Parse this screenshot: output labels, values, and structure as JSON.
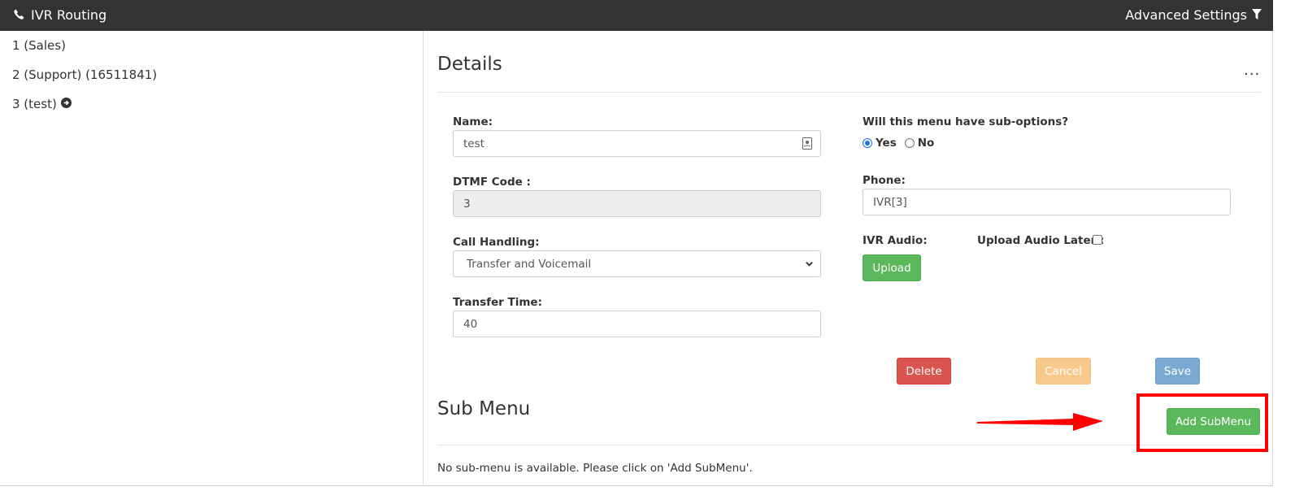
{
  "header": {
    "title": "IVR Routing",
    "advanced": "Advanced Settings"
  },
  "sidebar": {
    "items": [
      {
        "label": "1 (Sales)"
      },
      {
        "label": "2 (Support) (16511841)"
      },
      {
        "label": "3 (test)"
      }
    ]
  },
  "details": {
    "title": "Details",
    "more": "...",
    "name_label": "Name:",
    "name_value": "test",
    "dtmf_label": "DTMF Code :",
    "dtmf_value": "3",
    "call_label": "Call Handling:",
    "call_value": "Transfer and Voicemail",
    "transfer_label": "Transfer Time:",
    "transfer_value": "40",
    "suboptions_label": "Will this menu have sub-options?",
    "yes_label": "Yes",
    "no_label": "No",
    "suboptions_selected": "Yes",
    "phone_label": "Phone:",
    "phone_value": "IVR[3]",
    "ivr_audio_label": "IVR Audio:",
    "upload_later_label": "Upload Audio Later :",
    "upload_button": "Upload"
  },
  "actions": {
    "delete": "Delete",
    "cancel": "Cancel",
    "save": "Save"
  },
  "submenu": {
    "title": "Sub Menu",
    "add_button": "Add SubMenu",
    "empty_text": "No sub-menu is available. Please click on 'Add SubMenu'."
  },
  "colors": {
    "header_bg": "#333333",
    "green": "#5cb85c",
    "red": "#d9534f",
    "orange": "#f8c98d",
    "blue": "#7aa9d2",
    "annotation": "#ff0000"
  }
}
